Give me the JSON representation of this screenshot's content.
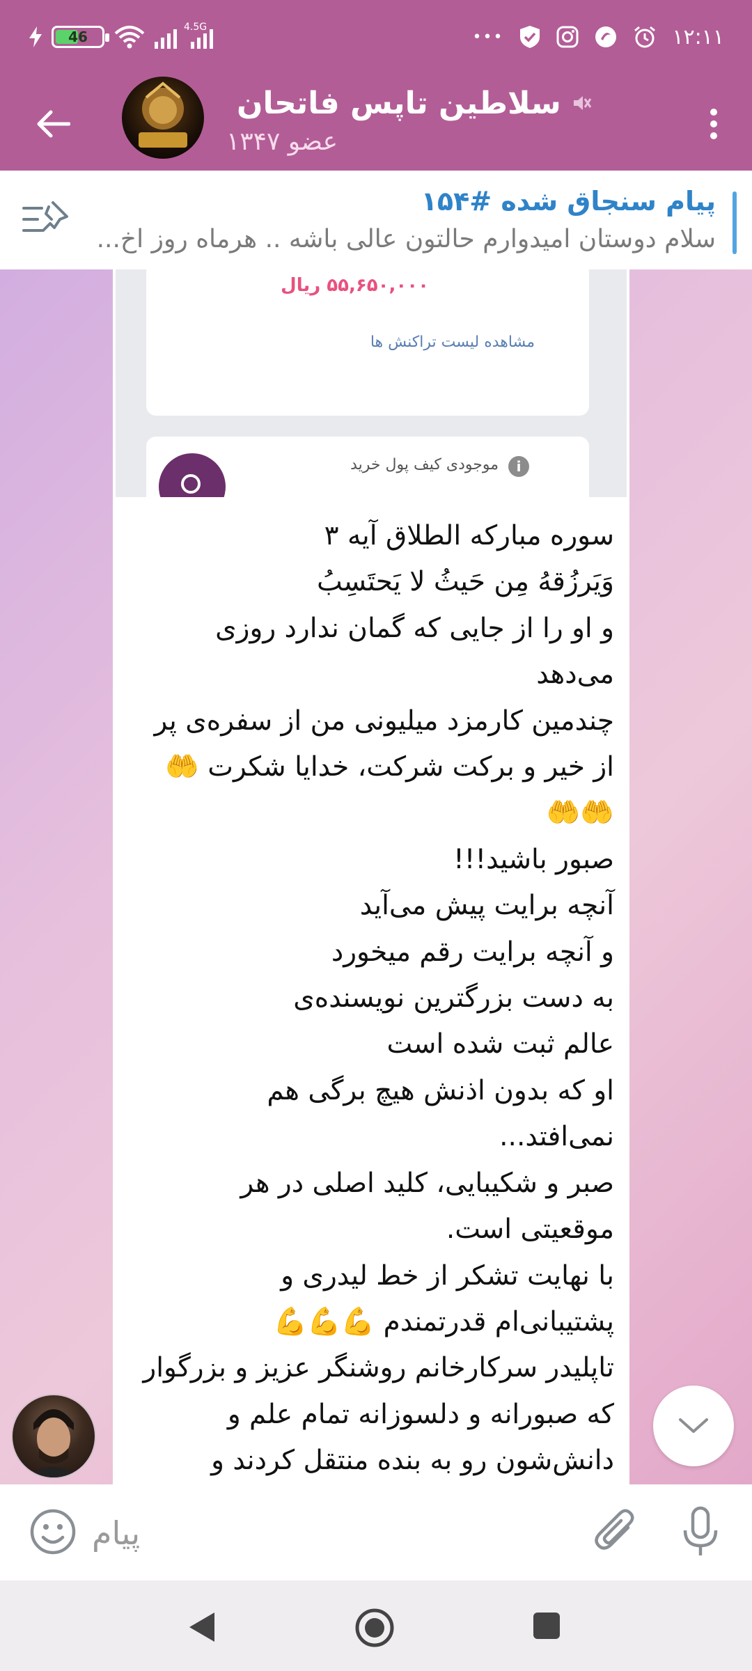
{
  "status_bar": {
    "time": "۱۲:۱۱",
    "battery": "46",
    "network": "4.5G",
    "more": "•••"
  },
  "header": {
    "title": "سلاطین تاپس فاتحان",
    "subtitle": "۱۳۴۷ عضو"
  },
  "pinned": {
    "title": "پیام سنجاق شده #۱۵۴",
    "text": "سلام دوستان امیدوارم حالتون عالی باشه .. هرماه روز اخ..."
  },
  "screenshot": {
    "amount": "۵۵,۶۵۰,۰۰۰ ریال",
    "link": "مشاهده لیست تراکنش ها",
    "wallet_label": "موجودی کیف پول خرید"
  },
  "message": {
    "text": "سوره مبارکه الطلاق آیه ۳\nوَیَرزُقهُ مِن حَیثُ لا یَحتَسِبُ\nو او را از جایی که گمان ندارد روزی\nمی‌دهد\nچندمین کارمزد میلیونی من از سفره‌ی پر\nاز خیر و برکت شرکت، خدایا شکرت 🤲\n🤲🤲\nصبور باشید!!!\nآنچه برایت پیش می‌آید\nو آنچه برایت رقم میخورد\nبه دست بزرگترین نویسنده‌ی\nعالم ثبت شده است\nاو که بدون اذنش هیچ برگی هم\nنمی‌افتد...\nصبر و شکیبایی، کلید اصلی در هر\nموقعیتی است.\nبا نهایت تشکر از خط لیدری و\nپشتیبانی‌ام قدرتمندم 💪💪💪\nتاپلیدر سرکارخانم روشنگر عزیز و بزرگوار\nکه صبورانه و دلسوزانه تمام علم و\nدانش‌شون رو به بنده منتقل کردند و"
  },
  "input": {
    "placeholder": "پیام"
  },
  "colors": {
    "header": "#b35d97",
    "pinned_title": "#2f83c8",
    "amount": "#e8517f"
  },
  "icons": {
    "back": "arrow-left-icon",
    "menu": "more-vertical-icon",
    "mute": "mute-icon",
    "pinned": "pin-list-icon",
    "scroll_down": "chevron-down-icon",
    "emoji": "emoji-icon",
    "attach": "paperclip-icon",
    "mic": "microphone-icon"
  }
}
